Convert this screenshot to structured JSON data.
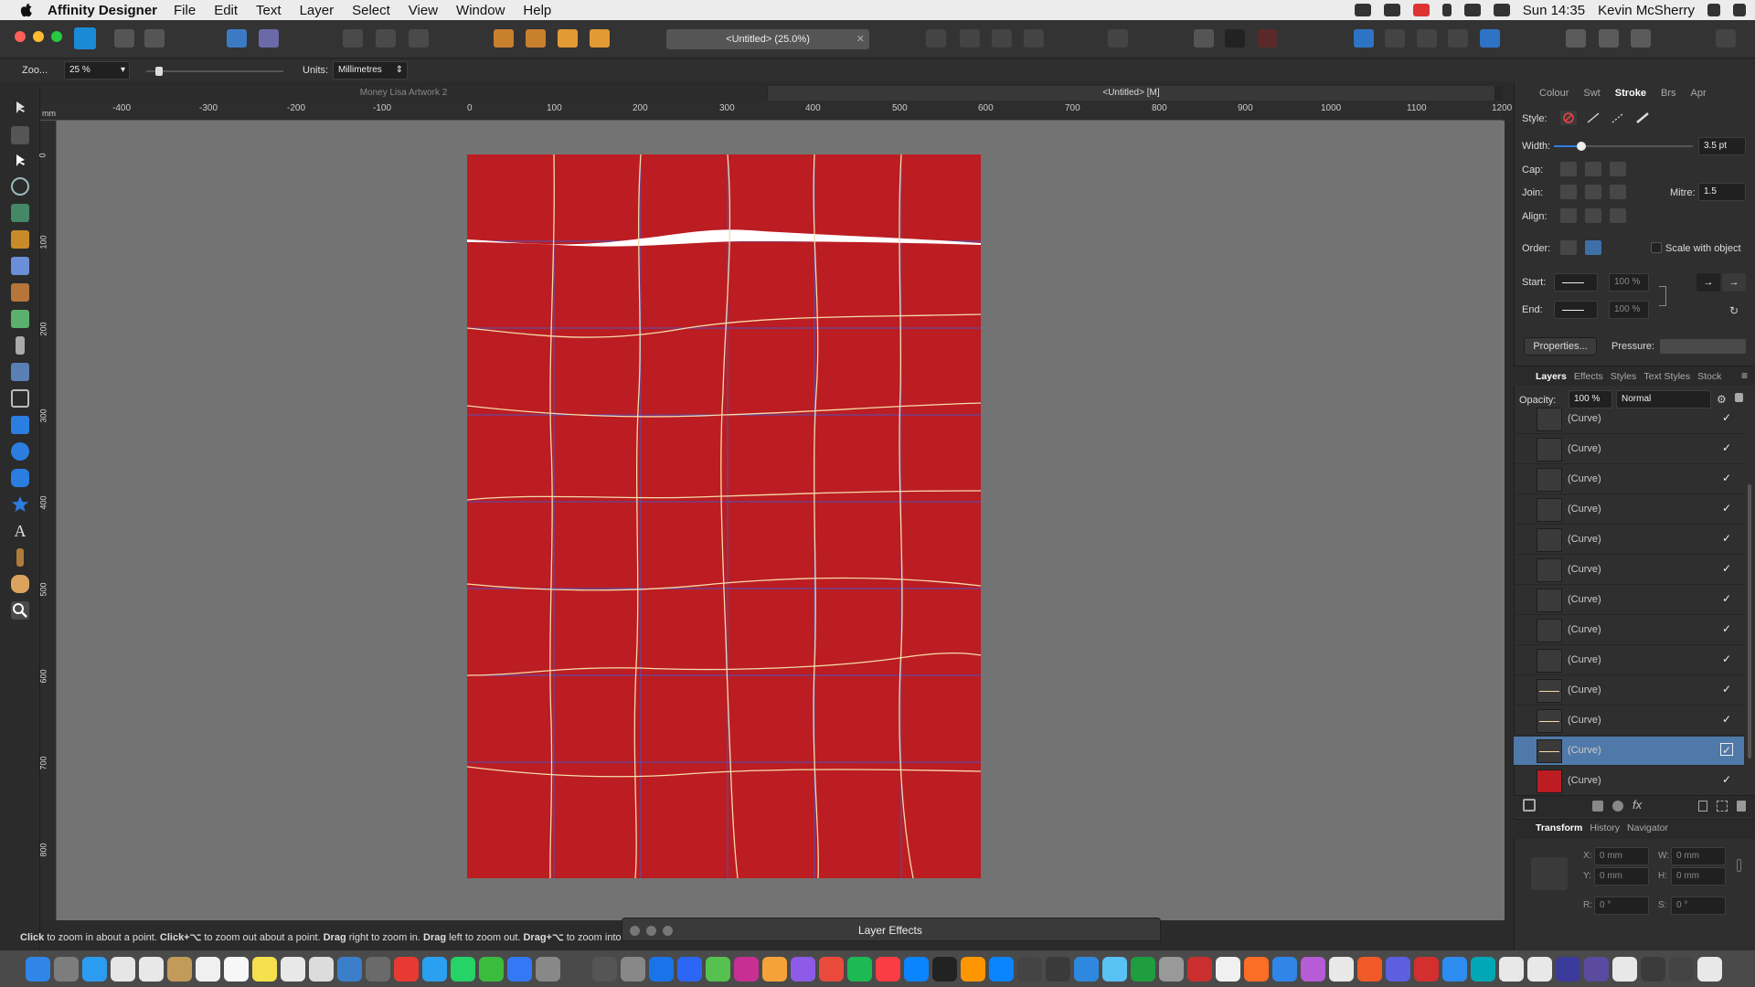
{
  "menubar": {
    "app_name": "Affinity Designer",
    "menus": [
      "File",
      "Edit",
      "Text",
      "Layer",
      "Select",
      "View",
      "Window",
      "Help"
    ],
    "clock": "Sun 14:35",
    "user": "Kevin McSherry"
  },
  "toolbar": {
    "document_title": "<Untitled> (25.0%)"
  },
  "context": {
    "zoom_label": "Zoo...",
    "zoom_value": "25 %",
    "units_label": "Units:",
    "units_value": "Millimetres"
  },
  "doc_tabs": {
    "tab1": "Money Lisa Artwork 2",
    "tab2": "<Untitled> [M]"
  },
  "ruler": {
    "unit": "mm",
    "h_ticks": [
      "-400",
      "-300",
      "-200",
      "-100",
      "0",
      "100",
      "200",
      "300",
      "400",
      "500",
      "600",
      "700",
      "800",
      "900",
      "1000",
      "1100",
      "1200"
    ],
    "v_ticks": [
      "0",
      "100",
      "200",
      "300",
      "400",
      "500",
      "600",
      "700",
      "800"
    ]
  },
  "stroke_panel": {
    "tabs": [
      "Colour",
      "Swt",
      "Stroke",
      "Brs",
      "Apr"
    ],
    "active_tab": "Stroke",
    "style_label": "Style:",
    "width_label": "Width:",
    "width_value": "3.5 pt",
    "width_fraction": 0.2,
    "cap_label": "Cap:",
    "join_label": "Join:",
    "mitre_label": "Mitre:",
    "mitre_value": "1.5",
    "align_label": "Align:",
    "order_label": "Order:",
    "scale_label": "Scale with object",
    "start_label": "Start:",
    "end_label": "End:",
    "start_pct": "100 %",
    "end_pct": "100 %",
    "properties_button": "Properties...",
    "pressure_label": "Pressure:"
  },
  "layers_panel": {
    "tabs": [
      "Layers",
      "Effects",
      "Styles",
      "Text Styles",
      "Stock"
    ],
    "active_tab": "Layers",
    "opacity_label": "Opacity:",
    "opacity_value": "100 %",
    "blend_mode": "Normal",
    "layers": [
      {
        "name": "(Curve)",
        "check": "✓"
      },
      {
        "name": "(Curve)",
        "check": "✓"
      },
      {
        "name": "(Curve)",
        "check": "✓"
      },
      {
        "name": "(Curve)",
        "check": "✓"
      },
      {
        "name": "(Curve)",
        "check": "✓"
      },
      {
        "name": "(Curve)",
        "check": "✓"
      },
      {
        "name": "(Curve)",
        "check": "✓"
      },
      {
        "name": "(Curve)",
        "check": "✓"
      },
      {
        "name": "(Curve)",
        "check": "✓"
      },
      {
        "name": "(Curve)",
        "check": "✓"
      },
      {
        "name": "(Curve)",
        "check": "✓"
      },
      {
        "name": "(Curve)",
        "check": "✓"
      },
      {
        "name": "(Curve)",
        "check": "✓"
      }
    ],
    "selected_index": 11
  },
  "transform_panel": {
    "tabs": [
      "Transform",
      "History",
      "Navigator"
    ],
    "active_tab": "Transform",
    "x_label": "X:",
    "x_value": "0 mm",
    "y_label": "Y:",
    "y_value": "0 mm",
    "w_label": "W:",
    "w_value": "0 mm",
    "h_label": "H:",
    "h_value": "0 mm",
    "r_label": "R:",
    "r_value": "0 °",
    "s_label": "S:",
    "s_value": "0 °"
  },
  "status": {
    "b1": "Click",
    "t1": " to zoom in about a point. ",
    "b2": "Click+⌥",
    "t2": " to zoom out about a point. ",
    "b3": "Drag",
    "t3": " right to zoom in. ",
    "b4": "Drag",
    "t4": " left to zoom out. ",
    "b5": "Drag+⌥",
    "t5": " to zoom into"
  },
  "fx_panel": {
    "title": "Layer Effects"
  },
  "colors": {
    "artboard_red": "#bb1d22",
    "selection_blue": "#4f79a8",
    "canvas_gray": "#737373",
    "grid_line_blue": "#3d5bd9",
    "curve_cream": "#f5dba8"
  }
}
